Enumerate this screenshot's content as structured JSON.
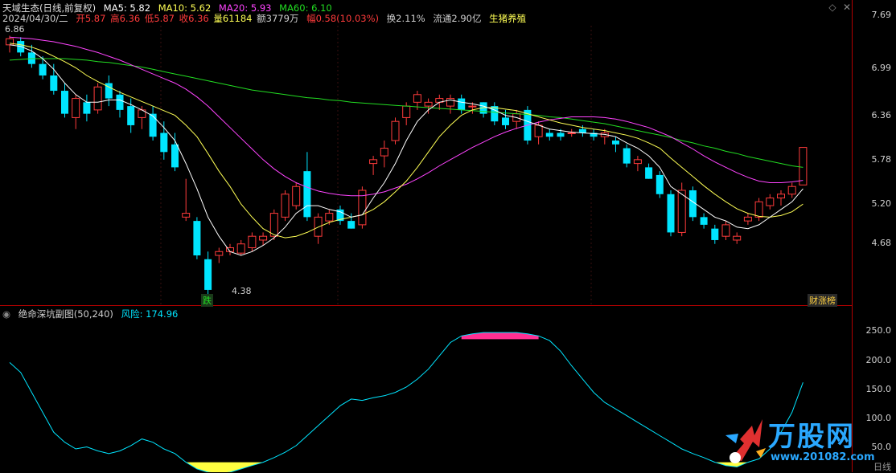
{
  "header": {
    "title": "天域生态(日线,前复权)",
    "ma5": "MA5: 5.82",
    "ma10": "MA10: 5.62",
    "ma20": "MA20: 5.93",
    "ma60": "MA60: 6.10",
    "date": "2024/04/30/二",
    "open": "开5.87",
    "high": "高6.36",
    "low": "低5.87",
    "close": "收6.36",
    "volume": "量61184",
    "amount": "额3779万",
    "amplitude": "幅0.58(10.03%)",
    "turnover": "换2.11%",
    "float": "流通2.90亿",
    "sector": "生猪养殖"
  },
  "main_axis": {
    "ticks": [
      "7.69",
      "6.99",
      "6.36",
      "5.78",
      "5.20",
      "4.68"
    ]
  },
  "annotations": {
    "low_label": "4.38",
    "badge_down": "跌",
    "badge_right": "财涨榜",
    "top_left_mark": "6.86"
  },
  "sub": {
    "title": "绝命深坑副图(50,240)",
    "risk": "风险: 174.96",
    "ticks": [
      "250.0",
      "200.0",
      "150.0",
      "100.0",
      "50.0"
    ]
  },
  "bottom_label": "日线",
  "logo": {
    "name": "万股网",
    "url": "www.201082.com"
  },
  "colors": {
    "up": "#ff3b3b",
    "down": "#00e5ff",
    "ma5": "#ffffff",
    "ma10": "#ffff55",
    "ma20": "#ff44ff",
    "ma60": "#22dd22",
    "risk": "#00e5ff",
    "top_fill": "#ff2f92",
    "bottom_fill": "#ffff40"
  },
  "chart_data": {
    "type": "candlestick",
    "ylim": [
      4.3,
      7.95
    ],
    "candles": [
      [
        7.7,
        7.82,
        7.6,
        7.78
      ],
      [
        7.75,
        7.8,
        7.55,
        7.6
      ],
      [
        7.6,
        7.7,
        7.4,
        7.45
      ],
      [
        7.45,
        7.55,
        7.25,
        7.3
      ],
      [
        7.3,
        7.45,
        7.05,
        7.1
      ],
      [
        7.1,
        7.2,
        6.75,
        6.8
      ],
      [
        6.75,
        7.05,
        6.6,
        7.0
      ],
      [
        6.95,
        7.05,
        6.7,
        6.8
      ],
      [
        6.85,
        7.2,
        6.8,
        7.15
      ],
      [
        7.2,
        7.3,
        6.9,
        7.0
      ],
      [
        7.05,
        7.1,
        6.75,
        6.85
      ],
      [
        6.9,
        7.0,
        6.55,
        6.65
      ],
      [
        6.75,
        6.9,
        6.6,
        6.85
      ],
      [
        6.8,
        6.9,
        6.45,
        6.5
      ],
      [
        6.55,
        6.7,
        6.2,
        6.3
      ],
      [
        6.4,
        6.55,
        6.05,
        6.1
      ],
      [
        5.45,
        5.95,
        5.4,
        5.5
      ],
      [
        5.4,
        5.45,
        4.9,
        4.95
      ],
      [
        4.9,
        5.0,
        4.38,
        4.5
      ],
      [
        4.95,
        5.05,
        4.85,
        5.0
      ],
      [
        5.0,
        5.1,
        4.95,
        5.05
      ],
      [
        4.98,
        5.15,
        4.95,
        5.1
      ],
      [
        5.05,
        5.25,
        5.0,
        5.2
      ],
      [
        5.15,
        5.25,
        5.08,
        5.2
      ],
      [
        5.2,
        5.55,
        5.15,
        5.5
      ],
      [
        5.45,
        5.8,
        5.4,
        5.75
      ],
      [
        5.6,
        5.9,
        5.55,
        5.85
      ],
      [
        6.05,
        6.3,
        5.4,
        5.45
      ],
      [
        5.2,
        5.5,
        5.1,
        5.45
      ],
      [
        5.4,
        5.55,
        5.35,
        5.5
      ],
      [
        5.55,
        5.6,
        5.35,
        5.4
      ],
      [
        5.4,
        5.5,
        5.3,
        5.3
      ],
      [
        5.35,
        5.85,
        5.3,
        5.8
      ],
      [
        6.15,
        6.25,
        6.0,
        6.2
      ],
      [
        6.25,
        6.45,
        6.1,
        6.35
      ],
      [
        6.45,
        6.75,
        6.4,
        6.7
      ],
      [
        6.75,
        6.95,
        6.65,
        6.9
      ],
      [
        6.95,
        7.1,
        6.85,
        7.05
      ],
      [
        6.9,
        7.0,
        6.8,
        6.95
      ],
      [
        6.95,
        7.05,
        6.85,
        7.0
      ],
      [
        6.9,
        7.05,
        6.8,
        7.0
      ],
      [
        7.0,
        7.05,
        6.8,
        6.85
      ],
      [
        6.9,
        6.95,
        6.8,
        6.9
      ],
      [
        6.95,
        6.95,
        6.75,
        6.8
      ],
      [
        6.9,
        6.95,
        6.65,
        6.7
      ],
      [
        6.75,
        6.85,
        6.6,
        6.65
      ],
      [
        6.7,
        6.85,
        6.6,
        6.8
      ],
      [
        6.85,
        6.9,
        6.4,
        6.45
      ],
      [
        6.5,
        6.7,
        6.4,
        6.65
      ],
      [
        6.55,
        6.6,
        6.45,
        6.5
      ],
      [
        6.55,
        6.6,
        6.45,
        6.5
      ],
      [
        6.55,
        6.6,
        6.5,
        6.55
      ],
      [
        6.6,
        6.65,
        6.5,
        6.55
      ],
      [
        6.55,
        6.6,
        6.45,
        6.5
      ],
      [
        6.5,
        6.6,
        6.4,
        6.55
      ],
      [
        6.45,
        6.5,
        6.3,
        6.4
      ],
      [
        6.35,
        6.4,
        6.1,
        6.15
      ],
      [
        6.15,
        6.25,
        6.05,
        6.2
      ],
      [
        6.1,
        6.15,
        5.95,
        5.95
      ],
      [
        6.0,
        6.05,
        5.7,
        5.75
      ],
      [
        5.75,
        5.8,
        5.2,
        5.25
      ],
      [
        5.25,
        5.9,
        5.2,
        5.8
      ],
      [
        5.8,
        5.85,
        5.4,
        5.45
      ],
      [
        5.45,
        5.5,
        5.3,
        5.35
      ],
      [
        5.3,
        5.35,
        5.1,
        5.15
      ],
      [
        5.2,
        5.4,
        5.15,
        5.35
      ],
      [
        5.15,
        5.25,
        5.1,
        5.2
      ],
      [
        5.4,
        5.5,
        5.35,
        5.45
      ],
      [
        5.45,
        5.7,
        5.4,
        5.65
      ],
      [
        5.6,
        5.75,
        5.55,
        5.7
      ],
      [
        5.7,
        5.8,
        5.6,
        5.75
      ],
      [
        5.75,
        5.9,
        5.7,
        5.85
      ],
      [
        5.87,
        6.36,
        5.87,
        6.36
      ]
    ],
    "ma5": [
      7.7,
      7.68,
      7.62,
      7.52,
      7.38,
      7.2,
      7.05,
      6.95,
      6.95,
      6.98,
      6.98,
      6.92,
      6.85,
      6.77,
      6.62,
      6.45,
      6.15,
      5.82,
      5.45,
      5.2,
      5.0,
      4.95,
      5.0,
      5.08,
      5.18,
      5.32,
      5.5,
      5.6,
      5.6,
      5.55,
      5.52,
      5.45,
      5.48,
      5.7,
      5.9,
      6.15,
      6.45,
      6.7,
      6.85,
      6.95,
      6.98,
      6.95,
      6.93,
      6.9,
      6.85,
      6.78,
      6.75,
      6.7,
      6.65,
      6.6,
      6.58,
      6.56,
      6.55,
      6.54,
      6.53,
      6.5,
      6.42,
      6.35,
      6.25,
      6.1,
      5.85,
      5.75,
      5.65,
      5.55,
      5.45,
      5.4,
      5.32,
      5.3,
      5.35,
      5.45,
      5.55,
      5.65,
      5.82
    ],
    "ma10": [
      7.72,
      7.7,
      7.67,
      7.62,
      7.55,
      7.48,
      7.4,
      7.3,
      7.22,
      7.15,
      7.08,
      7.02,
      6.96,
      6.9,
      6.84,
      6.78,
      6.65,
      6.5,
      6.28,
      6.05,
      5.85,
      5.62,
      5.45,
      5.3,
      5.22,
      5.18,
      5.2,
      5.25,
      5.32,
      5.38,
      5.42,
      5.45,
      5.48,
      5.55,
      5.65,
      5.78,
      5.92,
      6.1,
      6.3,
      6.5,
      6.65,
      6.78,
      6.85,
      6.88,
      6.88,
      6.86,
      6.84,
      6.8,
      6.76,
      6.72,
      6.68,
      6.65,
      6.62,
      6.6,
      6.58,
      6.55,
      6.52,
      6.48,
      6.42,
      6.35,
      6.22,
      6.1,
      5.98,
      5.86,
      5.75,
      5.65,
      5.56,
      5.5,
      5.46,
      5.45,
      5.47,
      5.52,
      5.62
    ],
    "ma20": [
      7.8,
      7.79,
      7.78,
      7.76,
      7.74,
      7.71,
      7.68,
      7.64,
      7.6,
      7.55,
      7.5,
      7.44,
      7.38,
      7.32,
      7.26,
      7.2,
      7.12,
      7.02,
      6.9,
      6.76,
      6.62,
      6.48,
      6.34,
      6.2,
      6.08,
      5.98,
      5.9,
      5.84,
      5.79,
      5.76,
      5.74,
      5.73,
      5.73,
      5.75,
      5.78,
      5.83,
      5.88,
      5.95,
      6.03,
      6.12,
      6.2,
      6.28,
      6.36,
      6.43,
      6.5,
      6.56,
      6.61,
      6.65,
      6.69,
      6.72,
      6.74,
      6.76,
      6.76,
      6.76,
      6.75,
      6.73,
      6.7,
      6.66,
      6.62,
      6.56,
      6.5,
      6.42,
      6.34,
      6.25,
      6.17,
      6.1,
      6.03,
      5.97,
      5.92,
      5.9,
      5.9,
      5.91,
      5.93
    ],
    "ma60": [
      7.5,
      7.51,
      7.52,
      7.52,
      7.52,
      7.52,
      7.51,
      7.5,
      7.48,
      7.47,
      7.45,
      7.43,
      7.41,
      7.38,
      7.35,
      7.32,
      7.29,
      7.26,
      7.23,
      7.2,
      7.17,
      7.14,
      7.11,
      7.09,
      7.07,
      7.05,
      7.03,
      7.01,
      7.0,
      6.98,
      6.97,
      6.95,
      6.94,
      6.93,
      6.92,
      6.91,
      6.9,
      6.89,
      6.88,
      6.87,
      6.86,
      6.85,
      6.84,
      6.83,
      6.82,
      6.81,
      6.8,
      6.79,
      6.78,
      6.76,
      6.75,
      6.73,
      6.71,
      6.69,
      6.67,
      6.64,
      6.61,
      6.58,
      6.55,
      6.52,
      6.49,
      6.45,
      6.42,
      6.38,
      6.35,
      6.31,
      6.28,
      6.24,
      6.21,
      6.18,
      6.15,
      6.12,
      6.1
    ],
    "risk": {
      "ylim": [
        40,
        290
      ],
      "values": [
        205,
        190,
        160,
        130,
        100,
        85,
        75,
        78,
        72,
        68,
        72,
        80,
        90,
        85,
        75,
        68,
        55,
        45,
        40,
        38,
        40,
        45,
        50,
        55,
        62,
        70,
        80,
        95,
        110,
        125,
        140,
        150,
        148,
        152,
        155,
        160,
        168,
        180,
        195,
        215,
        235,
        245,
        248,
        250,
        250,
        250,
        250,
        248,
        245,
        238,
        222,
        200,
        180,
        160,
        145,
        135,
        125,
        115,
        105,
        95,
        85,
        75,
        68,
        62,
        55,
        50,
        48,
        55,
        60,
        75,
        100,
        130,
        175
      ],
      "top_threshold": 240,
      "bottom_threshold": 55
    }
  }
}
